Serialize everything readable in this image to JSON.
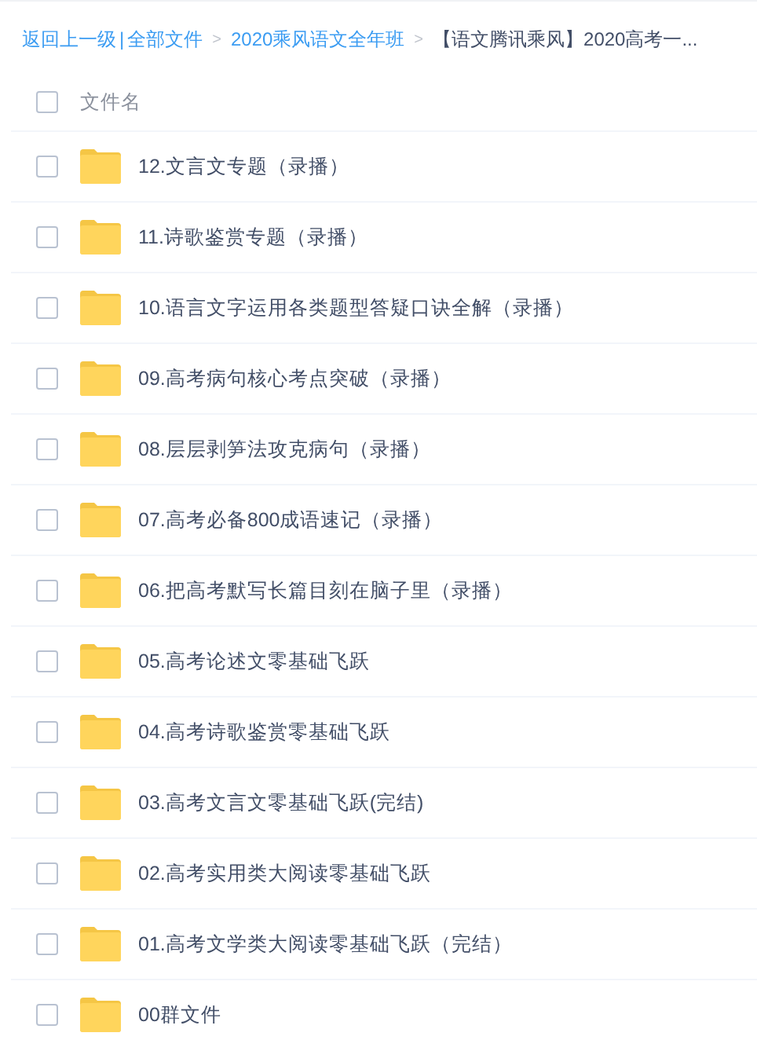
{
  "breadcrumb": [
    {
      "kind": "link",
      "text": "返回上一级"
    },
    {
      "kind": "bar",
      "text": "|"
    },
    {
      "kind": "link",
      "text": "全部文件"
    },
    {
      "kind": "arrow",
      "text": ">"
    },
    {
      "kind": "link",
      "text": "2020乘风语文全年班"
    },
    {
      "kind": "arrow",
      "text": ">"
    },
    {
      "kind": "current",
      "text": "【语文腾讯乘风】2020高考一..."
    }
  ],
  "header": {
    "label": "文件名",
    "checked": false
  },
  "files": [
    {
      "name": "12.文言文专题（录播）",
      "checked": false
    },
    {
      "name": "11.诗歌鉴赏专题（录播）",
      "checked": false
    },
    {
      "name": "10.语言文字运用各类题型答疑口诀全解（录播）",
      "checked": false
    },
    {
      "name": "09.高考病句核心考点突破（录播）",
      "checked": false
    },
    {
      "name": "08.层层剥笋法攻克病句（录播）",
      "checked": false
    },
    {
      "name": "07.高考必备800成语速记（录播）",
      "checked": false
    },
    {
      "name": "06.把高考默写长篇目刻在脑子里（录播）",
      "checked": false
    },
    {
      "name": "05.高考论述文零基础飞跃",
      "checked": false
    },
    {
      "name": "04.高考诗歌鉴赏零基础飞跃",
      "checked": false
    },
    {
      "name": "03.高考文言文零基础飞跃(完结)",
      "checked": false
    },
    {
      "name": "02.高考实用类大阅读零基础飞跃",
      "checked": false
    },
    {
      "name": "01.高考文学类大阅读零基础飞跃（完结）",
      "checked": false
    },
    {
      "name": "00群文件",
      "checked": false
    }
  ]
}
